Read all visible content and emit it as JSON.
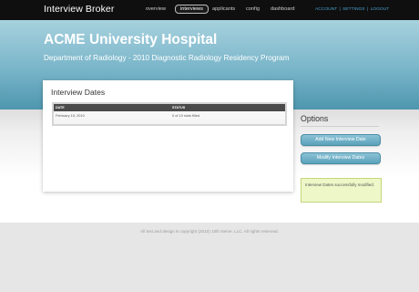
{
  "app": {
    "brand": "Interview Broker"
  },
  "nav": {
    "items": [
      {
        "label": "overview"
      },
      {
        "label": "interviews",
        "active": true
      },
      {
        "label": "applicants"
      },
      {
        "label": "config"
      },
      {
        "label": "dashboard"
      }
    ],
    "account_links": [
      "ACCOUNT",
      "SETTINGS",
      "LOGOUT"
    ],
    "separator": "|"
  },
  "header": {
    "title": "ACME University Hospital",
    "subtitle": "Department of Radiology - 2010 Diagnostic Radiology Residency Program"
  },
  "panel": {
    "title": "Interview Dates",
    "table": {
      "columns": [
        "DATE",
        "STATUS"
      ],
      "rows": [
        {
          "date": "February 15, 2010",
          "status": "0 of 10 slots filled"
        }
      ]
    }
  },
  "options": {
    "title": "Options",
    "add_button": "Add New Interview Date",
    "modify_button": "Modify Interview Dates",
    "notice": "Interview Dates successfully modified."
  },
  "footer": {
    "text": "All text and design is copyright (2010) 10th Nerve, LLC. All rights reserved."
  },
  "colors": {
    "topbar": "#0f0f0f",
    "hero_top": "#a7d1de",
    "hero_bottom": "#4e96ae",
    "accent_link": "#4aa0cf",
    "button": "#6fb0c6",
    "notice_bg": "#eef7c8",
    "table_header": "#4a4a4a"
  }
}
